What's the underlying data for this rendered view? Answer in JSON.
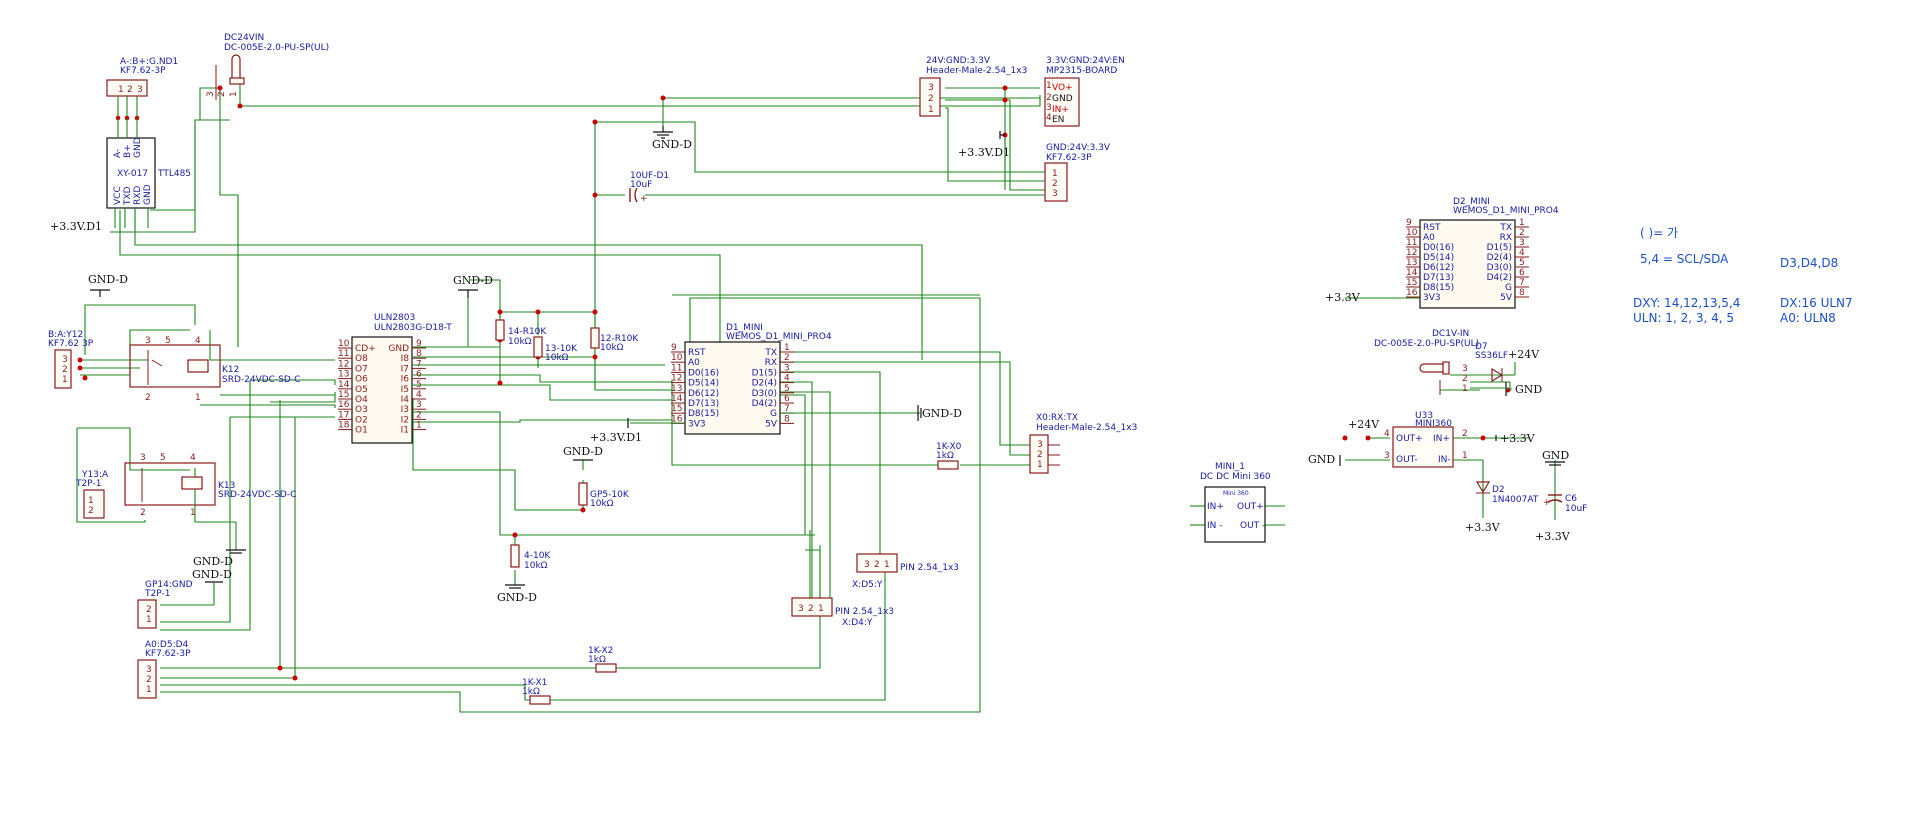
{
  "notes": {
    "n1": "( )=      가",
    "n2": "5,4 = SCL/SDA",
    "n3": "D3,D4,D8",
    "n4": "DXY: 14,12,13,5,4",
    "n5": "ULN: 1, 2, 3, 4, 5",
    "n6": "DX:16 ULN7",
    "n7": "A0:          ULN8"
  },
  "nets": {
    "gnd_d": "GND-D",
    "v33_d1": "+3.3V.D1",
    "v33": "+3.3V",
    "v24": "+24V",
    "gnd": "GND"
  },
  "components": {
    "dc24vin": {
      "ref": "DC24VIN",
      "value": "DC-005E-2.0-PU-SP(UL)"
    },
    "abgnd": {
      "ref": "A-:B+:G.ND1",
      "value": "KF7.62-3P",
      "pins": [
        "1",
        "2",
        "3"
      ]
    },
    "xy017": {
      "ref": "XY-017",
      "side": "TTL485",
      "top_pins": [
        "A-",
        "B+",
        "GND"
      ],
      "bottom_pins": [
        "VCC",
        "TXD",
        "RXD",
        "GND"
      ]
    },
    "hdr24": {
      "ref": "24V:GND:3.3V",
      "value": "Header-Male-2.54_1x3",
      "pins": [
        "3",
        "2",
        "1"
      ]
    },
    "mp2315": {
      "ref": "3.3V:GND:24V:EN",
      "value": "MP2315-BOARD",
      "pins": [
        "VO+",
        "GND",
        "IN+",
        "EN"
      ],
      "nums": [
        "1",
        "2",
        "3",
        "4"
      ]
    },
    "kf_gnd24": {
      "ref": "GND:24V:3.3V",
      "value": "KF7.62-3P",
      "pins": [
        "1",
        "2",
        "3"
      ]
    },
    "c10uf": {
      "ref": "10UF-D1",
      "value": "10uF"
    },
    "uln2803": {
      "ref": "ULN2803",
      "value": "ULN2803G-D18-T",
      "left": [
        "CD+",
        "O8",
        "O7",
        "O6",
        "O5",
        "O4",
        "O3",
        "O2",
        "O1"
      ],
      "left_nums": [
        "10",
        "11",
        "12",
        "13",
        "14",
        "15",
        "16",
        "17",
        "18"
      ],
      "right": [
        "GND",
        "I8",
        "I7",
        "I6",
        "I5",
        "I4",
        "I3",
        "I2",
        "I1"
      ],
      "right_nums": [
        "9",
        "8",
        "7",
        "6",
        "5",
        "4",
        "3",
        "2",
        "1"
      ]
    },
    "r14": {
      "ref": "14-R10K",
      "value": "10kΩ"
    },
    "r13": {
      "ref": "13-10K",
      "value": "10kΩ"
    },
    "r12": {
      "ref": "12-R10K",
      "value": "10kΩ"
    },
    "d1mini": {
      "ref": "D1_MINI",
      "value": "WEMOS_D1_MINI_PRO4",
      "left": [
        "RST",
        "A0",
        "D0(16)",
        "D5(14)",
        "D6(12)",
        "D7(13)",
        "D8(15)",
        "3V3"
      ],
      "left_nums": [
        "9",
        "10",
        "11",
        "12",
        "13",
        "14",
        "15",
        "16"
      ],
      "right": [
        "TX",
        "RX",
        "D1(5)",
        "D2(4)",
        "D3(0)",
        "D4(2)",
        "G",
        "5V"
      ],
      "right_nums": [
        "1",
        "2",
        "3",
        "4",
        "5",
        "6",
        "7",
        "8"
      ]
    },
    "d2mini": {
      "ref": "D2_MINI",
      "value": "WEMOS_D1_MINI_PRO4",
      "left": [
        "RST",
        "A0",
        "D0(16)",
        "D5(14)",
        "D6(12)",
        "D7(13)",
        "D8(15)",
        "3V3"
      ],
      "left_nums": [
        "9",
        "10",
        "11",
        "12",
        "13",
        "14",
        "15",
        "16"
      ],
      "right": [
        "TX",
        "RX",
        "D1(5)",
        "D2(4)",
        "D3(0)",
        "D4(2)",
        "G",
        "5V"
      ],
      "right_nums": [
        "1",
        "2",
        "3",
        "4",
        "5",
        "6",
        "7",
        "8"
      ]
    },
    "bay12": {
      "ref": "B:A:Y12",
      "value": "KF7.62 3P",
      "pins": [
        "3",
        "2",
        "1"
      ]
    },
    "k12": {
      "ref": "K12",
      "value": "SRD-24VDC-SD-C"
    },
    "k13": {
      "ref": "K13",
      "value": "SRD-24VDC-SD-C"
    },
    "y13": {
      "ref": "Y13:A",
      "value": "T2P-1",
      "pins": [
        "1",
        "2"
      ]
    },
    "gp14": {
      "ref": "GP14:GND",
      "value": "T2P-1",
      "pins": [
        "2",
        "1"
      ]
    },
    "a0d5d4": {
      "ref": "A0:D5:D4",
      "value": "KF7.62-3P",
      "pins": [
        "3",
        "2",
        "1"
      ]
    },
    "gp5": {
      "ref": "GP5-10K",
      "value": "10kΩ"
    },
    "r4": {
      "ref": "4-10K",
      "value": "10kΩ"
    },
    "rk2": {
      "ref": "1K-X2",
      "value": "1kΩ"
    },
    "rk1": {
      "ref": "1K-X1",
      "value": "1kΩ"
    },
    "rk0": {
      "ref": "1K-X0",
      "value": "1kΩ"
    },
    "pin_d5y": {
      "value": "PIN 2.54_1x3",
      "ref": "X:D5:Y",
      "pins": [
        "3",
        "2",
        "1"
      ]
    },
    "pin_d4y": {
      "value": "PIN 2.54_1x3",
      "ref": "X:D4:Y",
      "pins": [
        "3",
        "2",
        "1"
      ]
    },
    "x0rxtx": {
      "ref": "X0:RX:TX",
      "value": "Header-Male-2.54_1x3",
      "pins": [
        "3",
        "2",
        "1"
      ]
    },
    "mini1": {
      "ref": "MINI_1",
      "value": "DC DC Mini 360",
      "inner": "Mini 360",
      "pins": [
        "IN+",
        "OUT+",
        "IN -",
        "OUT -"
      ]
    },
    "dc1vin": {
      "ref": "DC1V-IN",
      "value": "DC-005E-2.0-PU-SP(UL)"
    },
    "d7": {
      "ref": "D7",
      "value": "SS36LF"
    },
    "u33": {
      "ref": "U33",
      "value": "MINI360",
      "pins": [
        "OUT+",
        "IN+",
        "OUT-",
        "IN-"
      ],
      "nums": [
        "4",
        "2",
        "3",
        "1"
      ]
    },
    "d2": {
      "ref": "D2",
      "value": "1N4007AT"
    },
    "c6": {
      "ref": "C6",
      "value": "10uF"
    }
  }
}
